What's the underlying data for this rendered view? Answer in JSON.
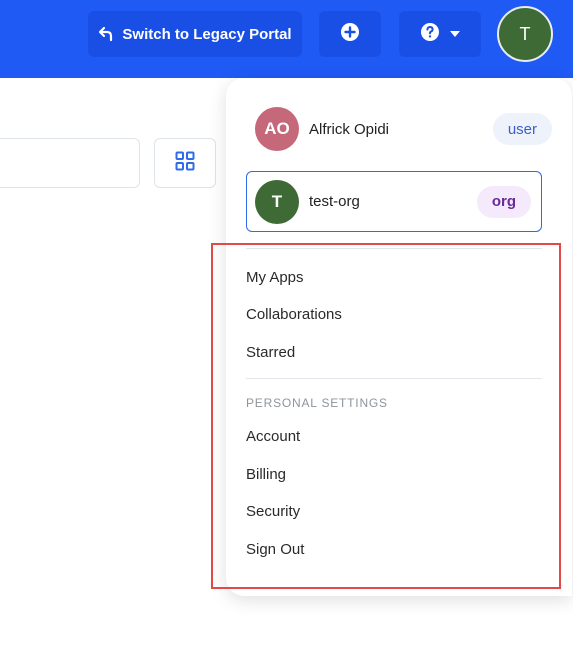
{
  "topbar": {
    "legacy_label": "Switch to Legacy Portal",
    "avatar_initial": "T"
  },
  "dropdown": {
    "user": {
      "initials": "AO",
      "name": "Alfrick Opidi",
      "badge": "user"
    },
    "org": {
      "initials": "T",
      "name": "test-org",
      "badge": "org"
    },
    "items": [
      "My Apps",
      "Collaborations",
      "Starred"
    ],
    "personal_settings_label": "PERSONAL SETTINGS",
    "settings_items": [
      "Account",
      "Billing",
      "Security",
      "Sign Out"
    ]
  },
  "colors": {
    "topbar": "#1f5af5",
    "highlight": "#e24a4a",
    "org_border": "#2f6ae8"
  }
}
